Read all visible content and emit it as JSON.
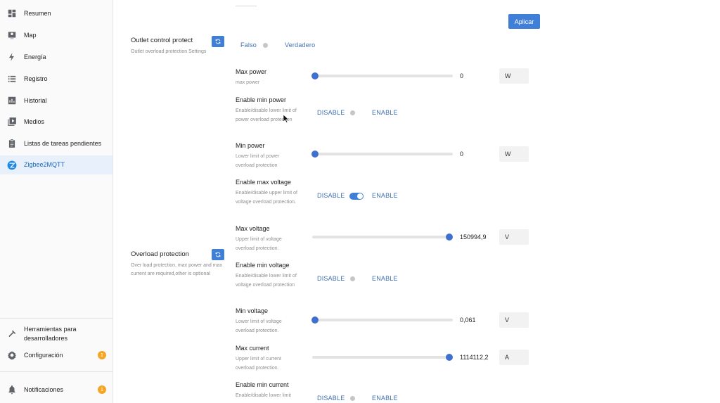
{
  "sidebar": {
    "items": [
      {
        "label": "Resumen",
        "icon": "dashboard-icon"
      },
      {
        "label": "Map",
        "icon": "map-icon"
      },
      {
        "label": "Energía",
        "icon": "lightning-icon"
      },
      {
        "label": "Registro",
        "icon": "list-icon"
      },
      {
        "label": "Historial",
        "icon": "chart-icon"
      },
      {
        "label": "Medios",
        "icon": "media-icon"
      },
      {
        "label": "Listas de tareas pendientes",
        "icon": "clipboard-icon"
      },
      {
        "label": "Zigbee2MQTT",
        "icon": "zigbee-icon",
        "active": true
      }
    ],
    "bottom": {
      "dev_tools": "Herramientas para desarrolladores",
      "config": "Configuración",
      "config_badge": "1",
      "notifications": "Notificaciones",
      "notifications_badge": "1"
    }
  },
  "main": {
    "apply_label": "Aplicar",
    "outlet": {
      "title": "Outlet control protect",
      "desc": "Outlet overload protection Settings",
      "false_label": "Falso",
      "true_label": "Verdadero"
    },
    "overload": {
      "title": "Overload protection",
      "desc": "Over load protection, max power and max current are required,other is optional"
    },
    "fields": {
      "max_power": {
        "title": "Max power",
        "desc": "max power",
        "value": "0",
        "unit": "W",
        "level": 0
      },
      "enable_min_power": {
        "title": "Enable min power",
        "desc": "Enable/disable lower limit of power overload protection",
        "off": "DISABLE",
        "on": "ENABLE",
        "state": "disable"
      },
      "min_power": {
        "title": "Min power",
        "desc": "Lower limit of power overload protection",
        "value": "0",
        "unit": "W",
        "level": 0
      },
      "enable_max_voltage": {
        "title": "Enable max voltage",
        "desc": "Enable/disable upper limit of voltage overload protection.",
        "off": "DISABLE",
        "on": "ENABLE",
        "state": "enable"
      },
      "max_voltage": {
        "title": "Max voltage",
        "desc": "Upper limit of voltage overload protection.",
        "value": "150994,9",
        "unit": "V",
        "level": 1
      },
      "enable_min_voltage": {
        "title": "Enable min voltage",
        "desc": "Enable/disable lower limit of voltage overload protection",
        "off": "DISABLE",
        "on": "ENABLE",
        "state": "disable"
      },
      "min_voltage": {
        "title": "Min voltage",
        "desc": "Lower limit of voltage overload protection.",
        "value": "0,061",
        "unit": "V",
        "level": 0
      },
      "max_current": {
        "title": "Max current",
        "desc": "Upper limit of current overload protection.",
        "value": "1114112,2",
        "unit": "A",
        "level": 1
      },
      "enable_min_current": {
        "title": "Enable min current",
        "desc": "Enable/disable lower limit",
        "off": "DISABLE",
        "on": "ENABLE",
        "state": "disable"
      }
    }
  },
  "colors": {
    "accent": "#3f7fd8",
    "active_bg": "#e8f1fb",
    "badge": "#f5a623"
  }
}
